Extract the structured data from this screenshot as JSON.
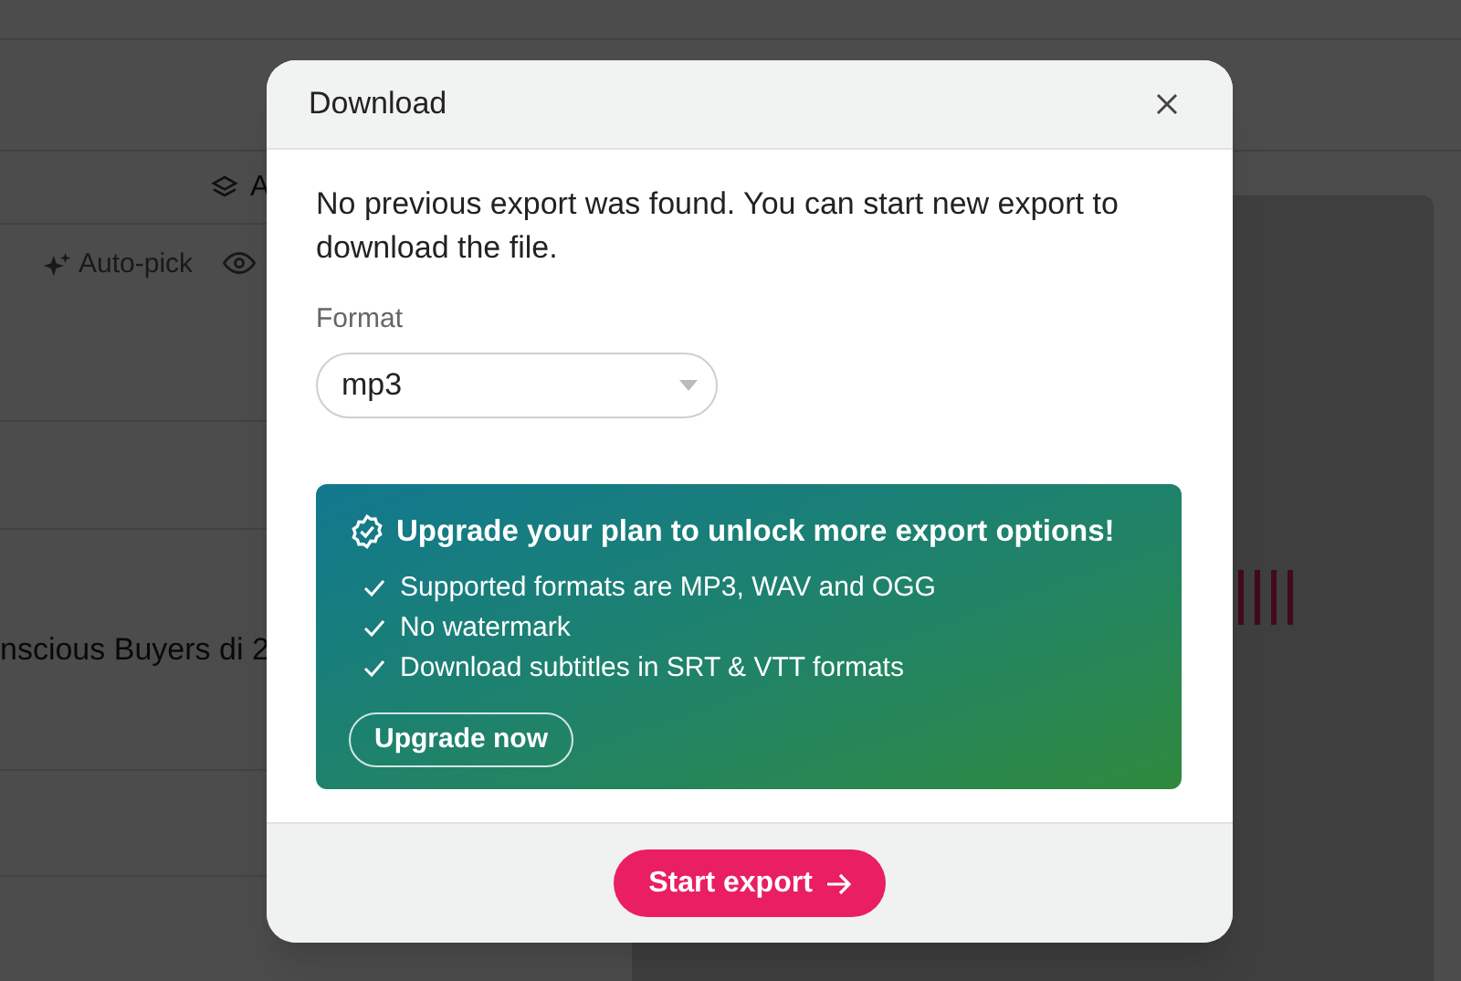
{
  "background": {
    "toolbar_label": "A",
    "autopick_label": "Auto-pick",
    "row_text": "nscious Buyers di 2"
  },
  "dialog": {
    "title": "Download",
    "message": "No previous export was found. You can start new export to download the file.",
    "format": {
      "label": "Format",
      "value": "mp3"
    },
    "upgrade": {
      "title": "Upgrade your plan to unlock more export options!",
      "features": [
        "Supported formats are MP3, WAV and OGG",
        "No watermark",
        "Download subtitles in SRT & VTT formats"
      ],
      "button": "Upgrade now"
    },
    "primary_button": "Start export"
  }
}
